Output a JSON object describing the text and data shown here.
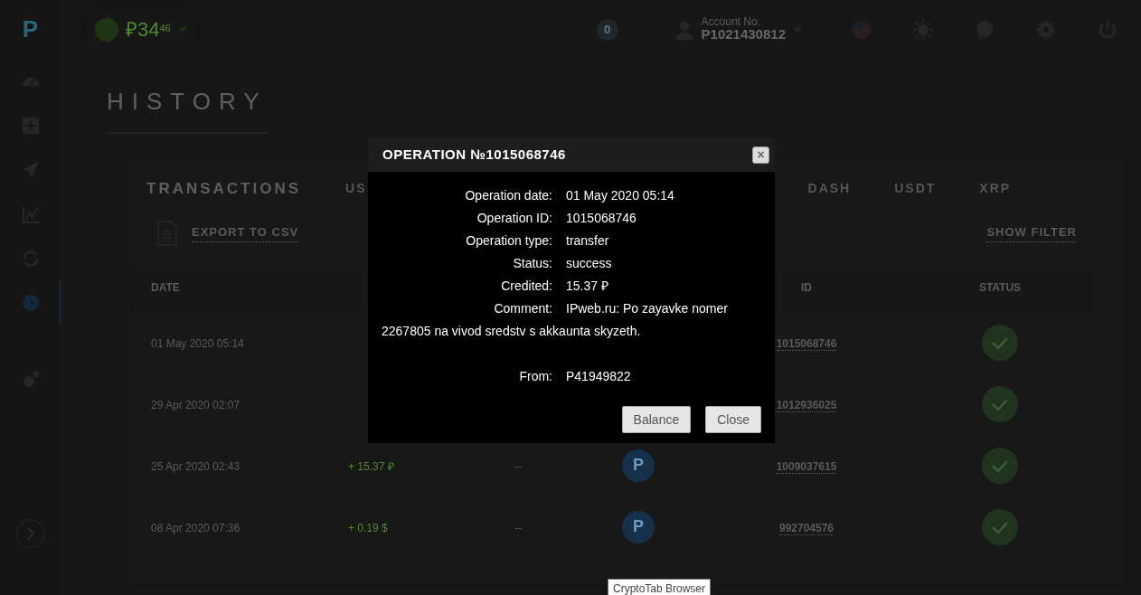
{
  "logo": "P",
  "header": {
    "balance": {
      "main": "₽34",
      "fraction": "46"
    },
    "notifications": "0",
    "account": {
      "label": "Account No.",
      "number": "P1021430812"
    }
  },
  "sidebar": {
    "items": [
      {
        "kind": "gauge",
        "selected": false
      },
      {
        "kind": "plus",
        "selected": false
      },
      {
        "kind": "plane",
        "selected": false
      },
      {
        "kind": "chart",
        "selected": false
      },
      {
        "kind": "exchange",
        "selected": false
      },
      {
        "kind": "clock",
        "selected": true
      },
      {
        "kind": "gears",
        "selected": false
      }
    ]
  },
  "page_title": "HISTORY",
  "section_title": "TRANSACTIONS",
  "tabs": [
    {
      "label": "US"
    },
    {
      "label": "DASH"
    },
    {
      "label": "USDT"
    },
    {
      "label": "XRP"
    }
  ],
  "actions": {
    "export": "EXPORT TO CSV",
    "filter": "SHOW FILTER"
  },
  "table": {
    "columns": {
      "date": "DATE",
      "id": "ID",
      "status": "STATUS"
    },
    "rows": [
      {
        "date": "01 May 2020 05:14",
        "id": "1015068746",
        "completed": true
      },
      {
        "date": "29 Apr 2020 02:07",
        "id": "1012936025",
        "completed": true
      },
      {
        "date": "25 Apr 2020 02:43",
        "amount": "+ 15.37 ₽",
        "column_3": "--",
        "coin": "P",
        "id": "1009037615",
        "completed": true
      },
      {
        "date": "08 Apr 2020 07:36",
        "amount": "+ 0.19 $",
        "column_3": "--",
        "coin": "P",
        "id": "992704576",
        "completed": true
      }
    ]
  },
  "dialog": {
    "title": "OPERATION №1015068746",
    "close": "×",
    "fields": [
      {
        "kind": "line",
        "label": "Operation date:",
        "value": "01 May 2020 05:14"
      },
      {
        "kind": "line",
        "label": "Operation ID:",
        "value": "1015068746"
      },
      {
        "kind": "line",
        "label": "Operation type:",
        "value": "transfer"
      },
      {
        "kind": "line",
        "label": "Status:",
        "value": "success"
      },
      {
        "kind": "line",
        "label": "Credited:",
        "value": "15.37 ₽"
      },
      {
        "kind": "wrap",
        "label": "Comment:",
        "value": "IPweb.ru: Po zayavke nomer 2267805 na vivod sredstv s akkaunta skyzeth."
      },
      {
        "kind": "line",
        "label": "From:",
        "value": "P41949822"
      }
    ],
    "buttons": [
      "Balance",
      "Close"
    ]
  },
  "tooltip": "CryptoTab Browser"
}
